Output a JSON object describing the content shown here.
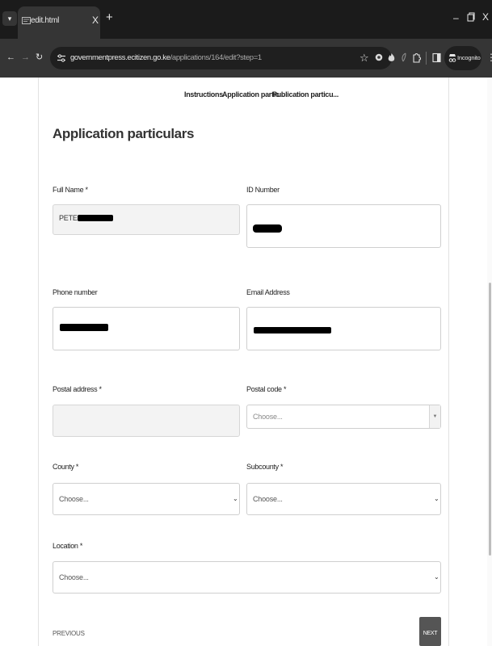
{
  "browser": {
    "tab_title": "edit.html",
    "tab_close": "X",
    "new_tab": "+",
    "window_min": "–",
    "window_close": "X",
    "url_host": "governmentpress.ecitizen.go.ke",
    "url_path": "/applications/164/edit?step=1",
    "incognito_label": "Incognito"
  },
  "form": {
    "steps": [
      "Instructions",
      "Application partic...",
      "Publication particu..."
    ],
    "title": "Application particulars",
    "fields": {
      "full_name": {
        "label": "Full Name",
        "required": "*",
        "value": "PETER"
      },
      "id_number": {
        "label": "ID Number"
      },
      "phone": {
        "label": "Phone number"
      },
      "email": {
        "label": "Email Address"
      },
      "postal_address": {
        "label": "Postal address",
        "required": "*",
        "value": ""
      },
      "postal_code": {
        "label": "Postal code",
        "required": "*",
        "placeholder": "Choose..."
      },
      "county": {
        "label": "County",
        "required": "*",
        "selected": "Choose..."
      },
      "subcounty": {
        "label": "Subcounty",
        "required": "*",
        "selected": "Choose..."
      },
      "location": {
        "label": "Location",
        "required": "*",
        "selected": "Choose..."
      }
    },
    "previous_label": "PREVIOUS",
    "next_label": "NEXT"
  }
}
